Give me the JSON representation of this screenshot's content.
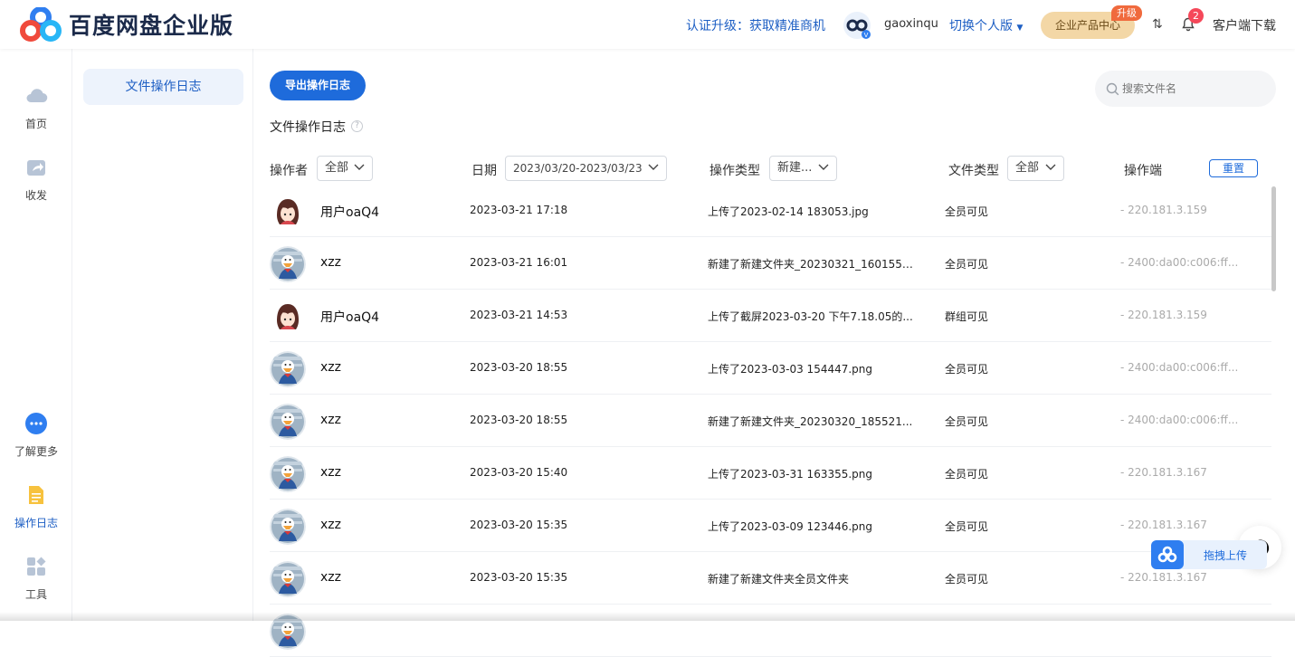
{
  "header": {
    "logo_text": "百度网盘企业版",
    "auth_upgrade": "认证升级：获取精准商机",
    "username": "gaoxinqu",
    "switch_personal": "切换个人版",
    "enterprise_center": "企业产品中心",
    "upgrade_badge": "升级",
    "notification_count": "2",
    "client_download": "客户端下载",
    "sort_glyph": "⇅"
  },
  "sidebar": {
    "items": [
      {
        "label": "首页",
        "icon": "cloud-icon"
      },
      {
        "label": "收发",
        "icon": "share-icon"
      },
      {
        "label": "了解更多",
        "icon": "more-icon"
      },
      {
        "label": "操作日志",
        "icon": "log-icon"
      },
      {
        "label": "工具",
        "icon": "tools-icon"
      }
    ]
  },
  "subnav": {
    "items": [
      {
        "label": "文件操作日志"
      }
    ]
  },
  "main": {
    "export_button": "导出操作日志",
    "search_placeholder": "搜索文件名",
    "section_title": "文件操作日志",
    "help_glyph": "?",
    "filters": {
      "operator_label": "操作者",
      "operator_value": "全部",
      "date_label": "日期",
      "date_value": "2023/03/20-2023/03/23",
      "op_type_label": "操作类型",
      "op_type_value": "新建...",
      "file_type_label": "文件类型",
      "file_type_value": "全部",
      "client_label": "操作端",
      "reset_button": "重置"
    },
    "rows": [
      {
        "name": "用户oaQ4",
        "avatar": "girl",
        "date": "2023-03-21 17:18",
        "operation": "上传了2023-02-14 183053.jpg",
        "file_type": "全员可见",
        "client": "- 220.181.3.159"
      },
      {
        "name": "xzz",
        "avatar": "duck",
        "date": "2023-03-21 16:01",
        "operation": "新建了新建文件夹_20230321_160155全...",
        "file_type": "全员可见",
        "client": "- 2400:da00:c006:ff..."
      },
      {
        "name": "用户oaQ4",
        "avatar": "girl",
        "date": "2023-03-21 14:53",
        "operation": "上传了截屏2023-03-20 下午7.18.05的...",
        "file_type": "群组可见",
        "client": "- 220.181.3.159"
      },
      {
        "name": "xzz",
        "avatar": "duck",
        "date": "2023-03-20 18:55",
        "operation": "上传了2023-03-03 154447.png",
        "file_type": "全员可见",
        "client": "- 2400:da00:c006:ff..."
      },
      {
        "name": "xzz",
        "avatar": "duck",
        "date": "2023-03-20 18:55",
        "operation": "新建了新建文件夹_20230320_185521...",
        "file_type": "全员可见",
        "client": "- 2400:da00:c006:ff..."
      },
      {
        "name": "xzz",
        "avatar": "duck",
        "date": "2023-03-20 15:40",
        "operation": "上传了2023-03-31 163355.png",
        "file_type": "全员可见",
        "client": "- 220.181.3.167"
      },
      {
        "name": "xzz",
        "avatar": "duck",
        "date": "2023-03-20 15:35",
        "operation": "上传了2023-03-09 123446.png",
        "file_type": "全员可见",
        "client": "- 220.181.3.167"
      },
      {
        "name": "xzz",
        "avatar": "duck",
        "date": "2023-03-20 15:35",
        "operation": "新建了新建文件夹全员文件夹",
        "file_type": "全员可见",
        "client": "- 220.181.3.167"
      },
      {
        "name": "",
        "avatar": "duck",
        "date": "",
        "operation": "",
        "file_type": "",
        "client": ""
      }
    ]
  },
  "upload_fab": {
    "label": "拖拽上传"
  },
  "colors": {
    "brand_blue": "#1e6bdb",
    "link_blue": "#1e5fc4",
    "enterprise_gold": "#f3d7a6",
    "badge_red": "#f5485a"
  }
}
